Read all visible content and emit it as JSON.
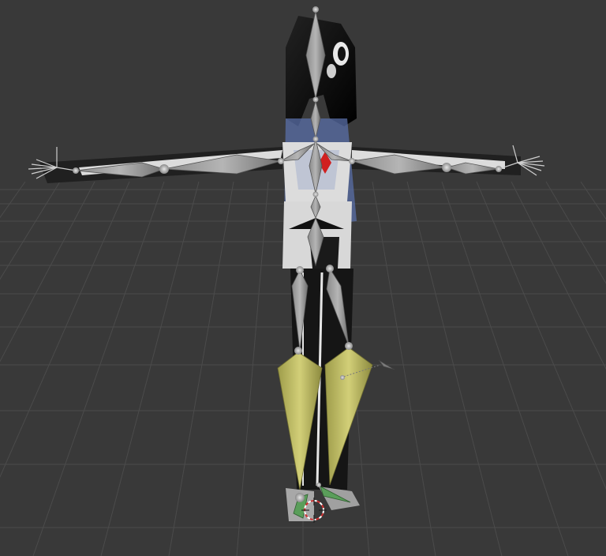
{
  "viewport": {
    "name": "3D Viewport",
    "background": "#393939",
    "grid_line_color": "#4a4a4a"
  },
  "armature": {
    "bone_color": "#a9a9a9",
    "bone_shadow": "#6f6f6f",
    "selected_bone_color": "#c9c66a",
    "ik_bone_color": "#5a9e5a"
  },
  "mesh": {
    "body_color": "#1a1a1a",
    "highlight_color": "#dcdcdc",
    "accent_color": "#d02020"
  },
  "cursor": {
    "icon": "3d-cursor-icon",
    "color": "#d03030"
  }
}
